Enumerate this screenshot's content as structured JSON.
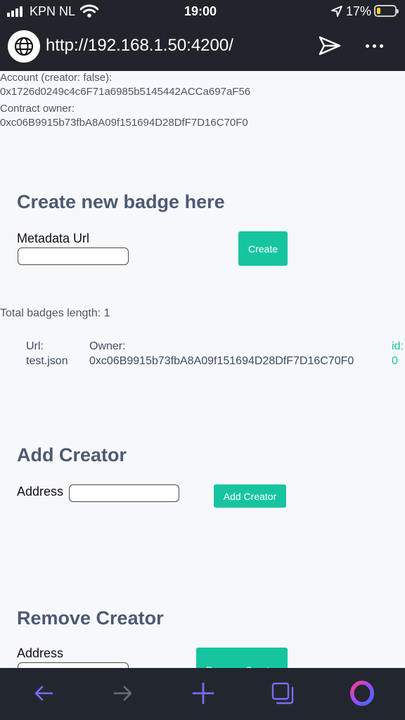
{
  "status_bar": {
    "carrier": "KPN NL",
    "time": "19:00",
    "battery": "17%"
  },
  "browser": {
    "url": "http://192.168.1.50:4200/"
  },
  "account": {
    "label": "Account (creator: false):",
    "address": "0x1726d0249c4c6F71a6985b5145442ACCa697aF56",
    "owner_label": "Contract owner:",
    "owner_address": "0xc06B9915b73fbA8A09f151694D28DfF7D16C70F0"
  },
  "create_badge": {
    "heading": "Create new badge here",
    "metadata_label": "Metadata Url",
    "metadata_value": "",
    "button": "Create"
  },
  "badges": {
    "total": "Total badges length: 1",
    "columns": [
      "Url:",
      "Owner:",
      "id:"
    ],
    "rows": [
      {
        "url": "test.json",
        "owner": "0xc06B9915b73fbA8A09f151694D28DfF7D16C70F0",
        "id": "0"
      }
    ]
  },
  "add_creator": {
    "heading": "Add Creator",
    "address_label": "Address",
    "address_value": "",
    "button": "Add Creator"
  },
  "remove_creator": {
    "heading": "Remove Creator",
    "address_label": "Address",
    "address_value": "",
    "button": "Remove Creator"
  },
  "icons": {
    "back": "arrow-left-icon",
    "forward": "arrow-right-icon",
    "new_tab": "plus-icon",
    "tabs": "tabs-icon",
    "menu": "opera-logo-icon"
  },
  "colors": {
    "accent": "#16c5a0",
    "heading": "#4e5a72",
    "chrome": "#21252b",
    "nav_icon": "#7b6cf2",
    "battery": "#f7d11a"
  }
}
